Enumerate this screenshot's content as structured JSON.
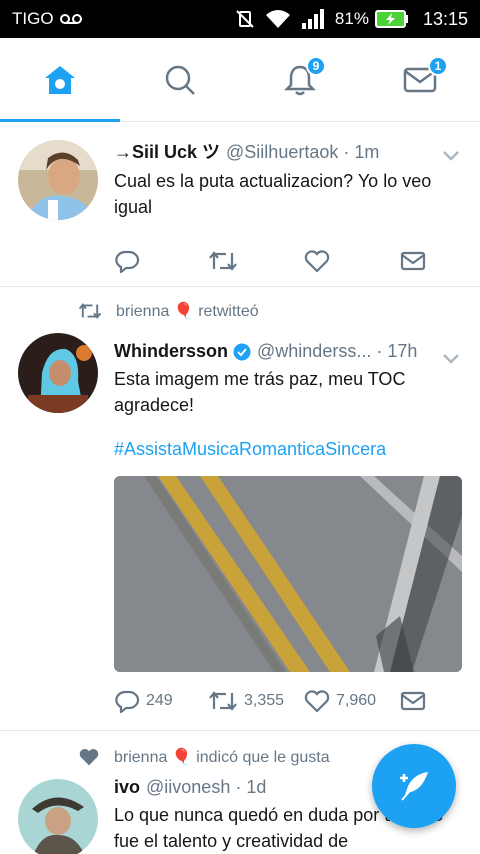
{
  "status_bar": {
    "carrier": "TIGO",
    "battery": "81%",
    "time": "13:15"
  },
  "nav": {
    "tabs": [
      {
        "name": "home",
        "icon": "home-icon",
        "active": true
      },
      {
        "name": "search",
        "icon": "search-icon"
      },
      {
        "name": "notifications",
        "icon": "bell-icon",
        "badge": "9"
      },
      {
        "name": "messages",
        "icon": "mail-icon",
        "badge": "1"
      }
    ]
  },
  "tweets": [
    {
      "name": "→Siil Uck ツ",
      "handle": "@Siilhuertaok",
      "sep": "·",
      "time": "1m",
      "text": "Cual es la puta actualizacion?  Yo lo veo igual"
    },
    {
      "social": "brienna 🎈 retwitteó",
      "name": "Whindersson",
      "handle": "@whinderss...",
      "sep": "·",
      "time": "17h",
      "text": "Esta imagem me trás paz, meu TOC agradece!",
      "hashtag": "#AssistaMusicaRomanticaSincera",
      "replies": "249",
      "retweets": "3,355",
      "likes": "7,960"
    },
    {
      "social": "brienna 🎈 indicó que le gusta",
      "name": "ivo",
      "handle": "@iivonesh",
      "sep": "·",
      "time": "1d",
      "text": "Lo que nunca quedó en duda por un lado fue el talento y creatividad de"
    }
  ],
  "colors": {
    "accent": "#1da1f2",
    "secondary_text": "#657786",
    "divider": "#e1e8ed"
  }
}
